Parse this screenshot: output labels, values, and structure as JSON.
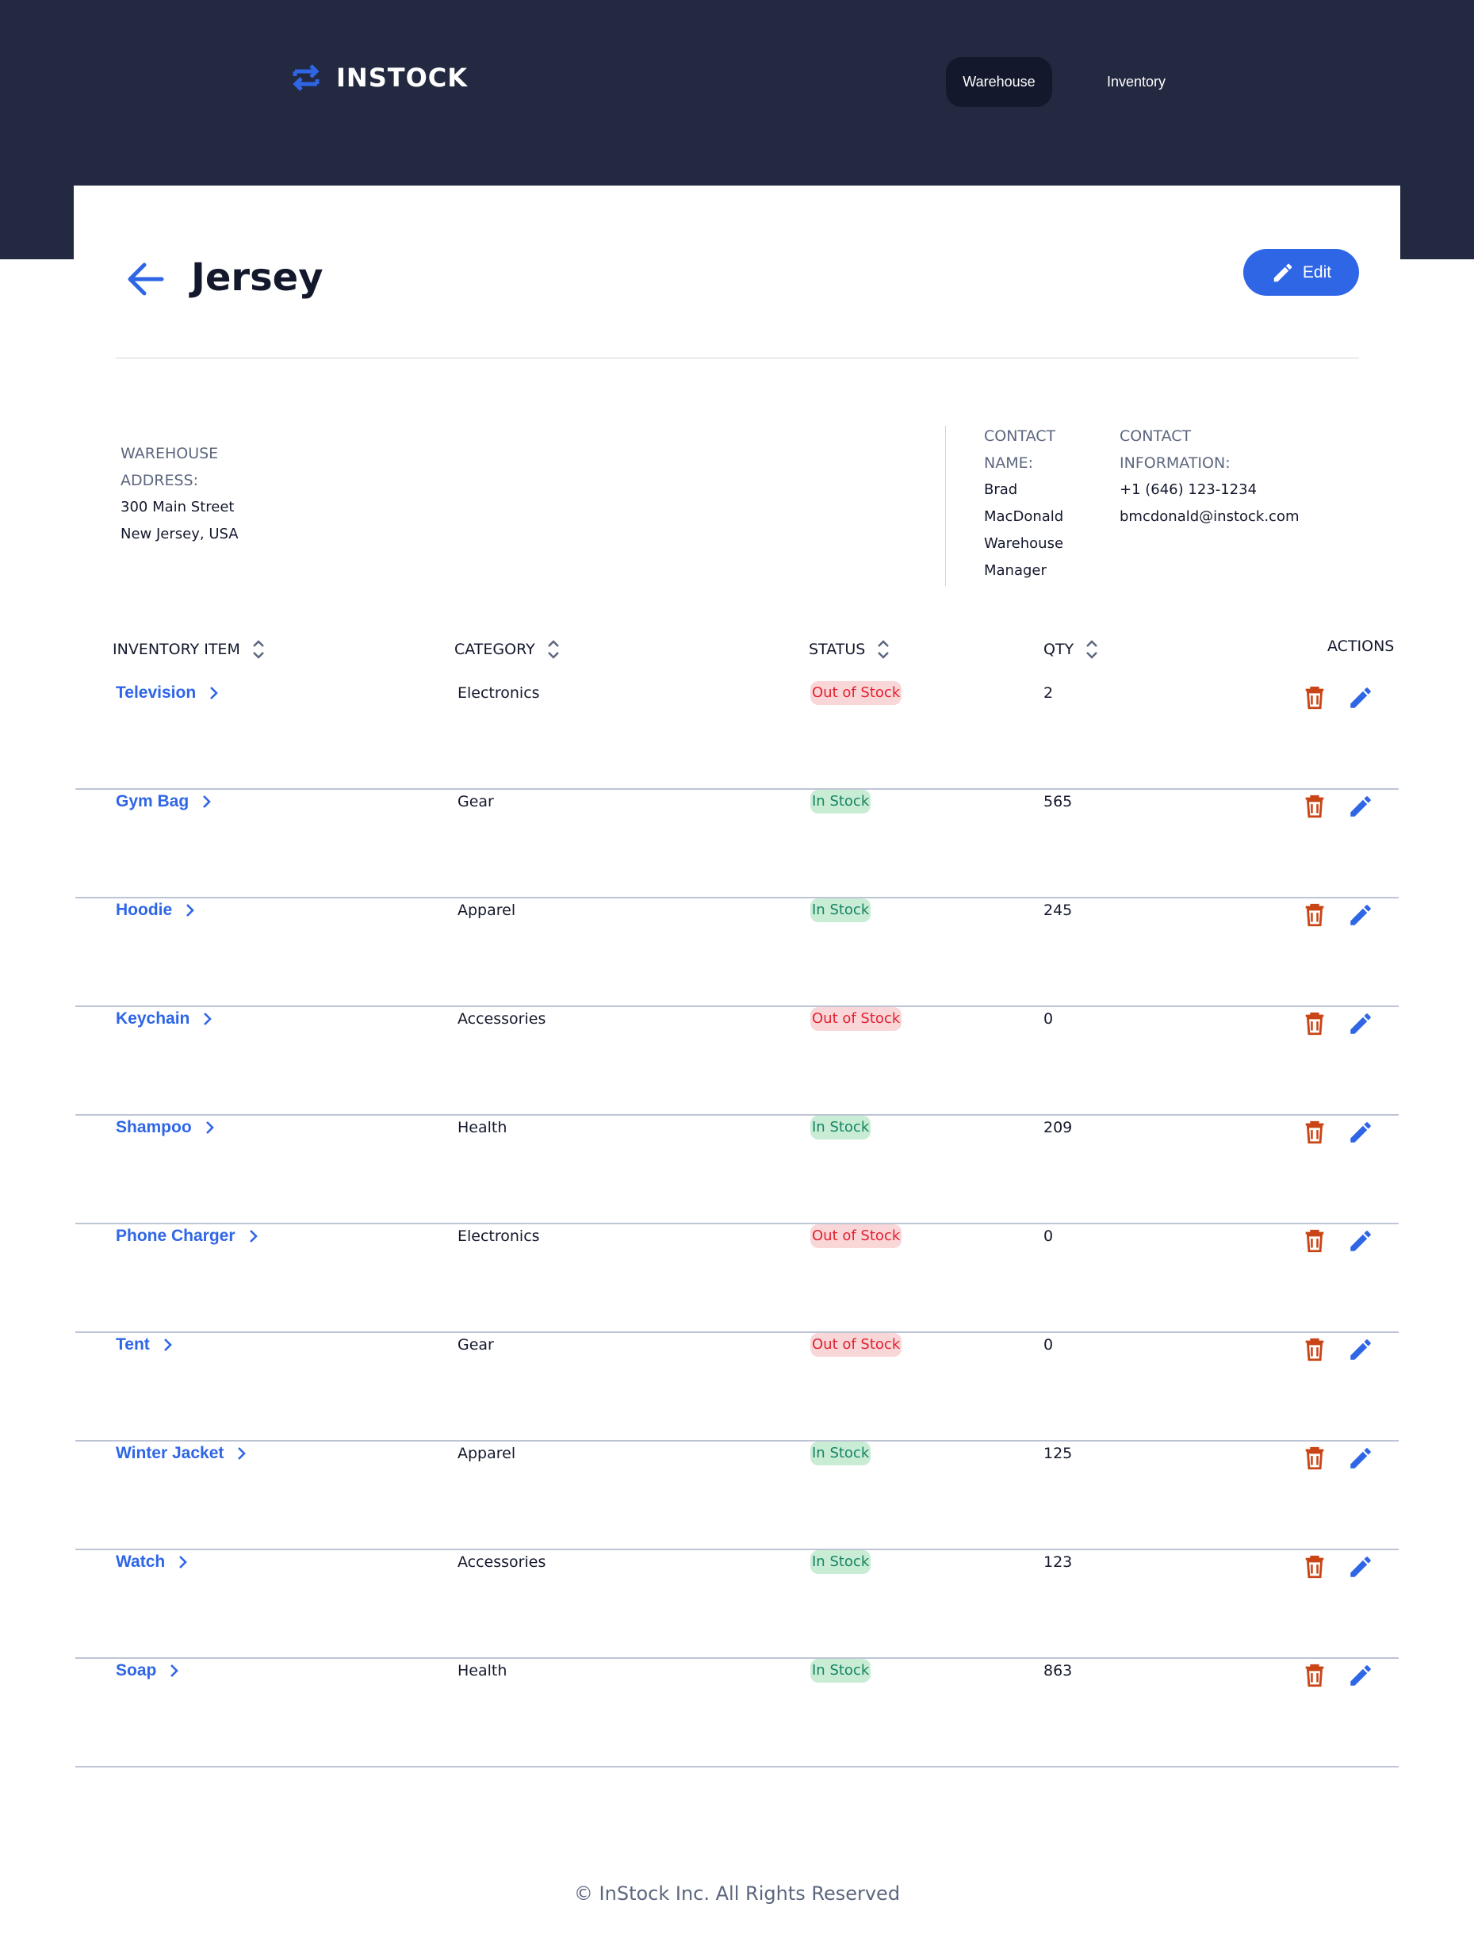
{
  "header": {
    "logo_text": "INSTOCK",
    "nav": {
      "warehouse_label": "Warehouse",
      "inventory_label": "Inventory"
    }
  },
  "page": {
    "title": "Jersey",
    "edit_label": "Edit"
  },
  "address": {
    "label_line1": "WAREHOUSE",
    "label_line2": "ADDRESS:",
    "line1": "300 Main Street",
    "line2": "New Jersey, USA"
  },
  "contact": {
    "name_label_line1": "CONTACT",
    "name_label_line2": "NAME:",
    "name_line1": "Brad",
    "name_line2": "MacDonald",
    "role_line1": "Warehouse",
    "role_line2": "Manager",
    "info_label_line1": "CONTACT",
    "info_label_line2": "INFORMATION:",
    "phone": "+1 (646) 123-1234",
    "email": "bmcdonald@instock.com"
  },
  "table": {
    "headers": {
      "item": "INVENTORY ITEM",
      "category": "CATEGORY",
      "status": "STATUS",
      "qty": "QTY",
      "actions": "ACTIONS"
    },
    "rows": [
      {
        "item": "Television",
        "category": "Electronics",
        "status": "Out of Stock",
        "qty": "2"
      },
      {
        "item": "Gym Bag",
        "category": "Gear",
        "status": "In Stock",
        "qty": "565"
      },
      {
        "item": "Hoodie",
        "category": "Apparel",
        "status": "In Stock",
        "qty": "245"
      },
      {
        "item": "Keychain",
        "category": "Accessories",
        "status": "Out of Stock",
        "qty": "0"
      },
      {
        "item": "Shampoo",
        "category": "Health",
        "status": "In Stock",
        "qty": "209"
      },
      {
        "item": "Phone Charger",
        "category": "Electronics",
        "status": "Out of Stock",
        "qty": "0"
      },
      {
        "item": "Tent",
        "category": "Gear",
        "status": "Out of Stock",
        "qty": "0"
      },
      {
        "item": "Winter Jacket",
        "category": "Apparel",
        "status": "In Stock",
        "qty": "125"
      },
      {
        "item": "Watch",
        "category": "Accessories",
        "status": "In Stock",
        "qty": "123"
      },
      {
        "item": "Soap",
        "category": "Health",
        "status": "In Stock",
        "qty": "863"
      }
    ]
  },
  "footer": {
    "text": "© InStock Inc. All Rights Reserved"
  },
  "colors": {
    "header_bg": "#232940",
    "accent": "#2e66e6",
    "delete": "#c94515",
    "in_stock": "#158463",
    "out_of_stock": "#e3212f"
  },
  "icons": [
    "swap-arrows-icon",
    "arrow-back-icon",
    "pencil-icon",
    "sort-icon",
    "chevron-right-icon",
    "trash-icon"
  ]
}
